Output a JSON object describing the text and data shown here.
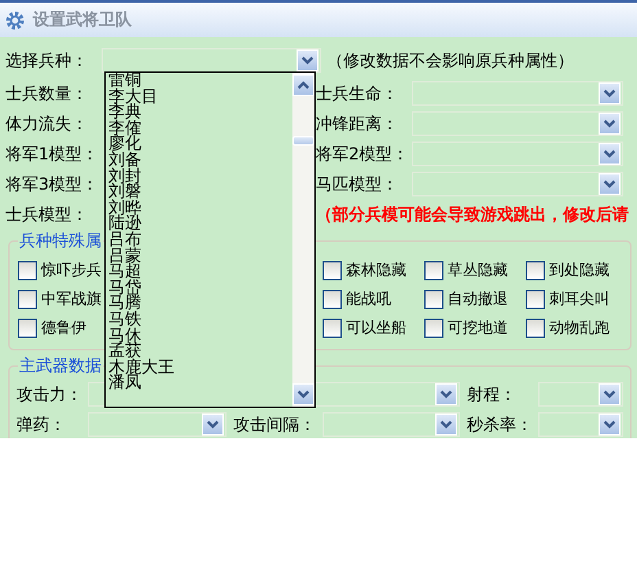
{
  "window": {
    "title": "设置武将卫队"
  },
  "unit_select": {
    "label": "选择兵种：",
    "note": "（修改数据不会影响原兵种属性）"
  },
  "fields_left": [
    "士兵数量：",
    "体力流失：",
    "将军1模型：",
    "将军3模型："
  ],
  "fields_right": [
    "士兵生命：",
    "冲锋距离：",
    "将军2模型：",
    "马匹模型："
  ],
  "soldier_model": {
    "label": "士兵模型：",
    "warning": "（部分兵模可能会导致游戏跳出，修改后请"
  },
  "special_group": {
    "title": "兵种特殊属",
    "checkboxes": [
      {
        "label": "惊吓步兵",
        "checked": false
      },
      {
        "label": "森林隐藏",
        "checked": false
      },
      {
        "label": "草丛隐藏",
        "checked": false
      },
      {
        "label": "到处隐藏",
        "checked": false
      },
      {
        "label": "中军战旗",
        "checked": false
      },
      {
        "label": "能战吼",
        "checked": false
      },
      {
        "label": "自动撤退",
        "checked": false
      },
      {
        "label": "刺耳尖叫",
        "checked": false
      },
      {
        "label": "德鲁伊",
        "checked": false
      },
      {
        "label": "可以坐船",
        "checked": false
      },
      {
        "label": "可挖地道",
        "checked": false
      },
      {
        "label": "动物乱跑",
        "checked": false
      }
    ]
  },
  "weapon_group": {
    "title": "主武器数据",
    "rows": [
      [
        "攻击力：",
        "",
        "射程："
      ],
      [
        "弹药：",
        "攻击间隔：",
        "秒杀率："
      ]
    ]
  },
  "dropdown_list": {
    "items": [
      {
        "label": "雷铜",
        "selected": false
      },
      {
        "label": "李大目",
        "selected": false
      },
      {
        "label": "李典",
        "selected": false
      },
      {
        "label": "李傕",
        "selected": false
      },
      {
        "label": "廖化",
        "selected": false
      },
      {
        "label": "刘备",
        "selected": false
      },
      {
        "label": "刘封",
        "selected": false
      },
      {
        "label": "刘磐",
        "selected": false
      },
      {
        "label": "刘晔",
        "selected": false
      },
      {
        "label": "陆逊",
        "selected": false
      },
      {
        "label": "吕布",
        "selected": false
      },
      {
        "label": "吕蒙",
        "selected": false
      },
      {
        "label": "马超",
        "selected": false
      },
      {
        "label": "马岱",
        "selected": false
      },
      {
        "label": "马腾",
        "selected": false
      },
      {
        "label": "马铁",
        "selected": false
      },
      {
        "label": "马休",
        "selected": false
      },
      {
        "label": "孟获",
        "selected": false
      },
      {
        "label": "木鹿大王",
        "selected": false
      },
      {
        "label": "潘凤",
        "selected": false
      }
    ]
  }
}
